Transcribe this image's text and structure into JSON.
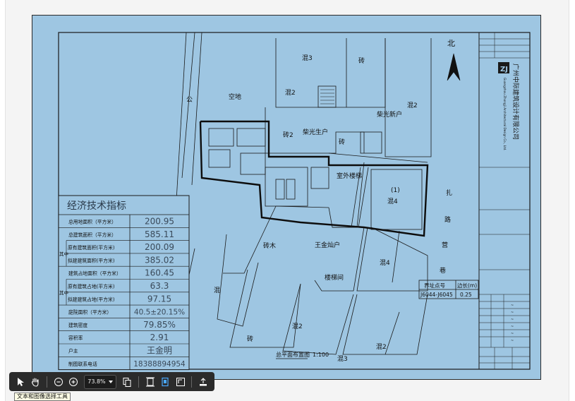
{
  "drawing": {
    "north_label": "北",
    "title_table": {
      "heading": "经济技术指标",
      "rows": [
        {
          "group": "",
          "label": "总用地面积（平方米）",
          "value": "200.95"
        },
        {
          "group": "",
          "label": "总建筑面积（平方米）",
          "value": "585.11"
        },
        {
          "group": "其中",
          "label": "原有建筑面积(平方米)",
          "value": "200.09"
        },
        {
          "group": "",
          "label": "拟建建筑面积(平方米)",
          "value": "385.02"
        },
        {
          "group": "",
          "label": "建筑占地面积（平方米）",
          "value": "160.45"
        },
        {
          "group": "其中",
          "label": "原有建筑占地(平方米)",
          "value": "63.3"
        },
        {
          "group": "",
          "label": "拟建建筑占地(平方米)",
          "value": "97.15"
        },
        {
          "group": "",
          "label": "庭院面积（平方米）",
          "value": "40.5±20.15%"
        },
        {
          "group": "",
          "label": "建筑密度",
          "value": "79.85%"
        },
        {
          "group": "",
          "label": "容积率",
          "value": "2.91"
        },
        {
          "group": "",
          "label": "户主",
          "value": "王金明"
        },
        {
          "group": "",
          "label": "制图联系电话",
          "value": "18388894954"
        }
      ]
    },
    "boundary_table": {
      "col1_header": "界址点号",
      "col2_header": "边长(m)",
      "col1_value": "J6044-J6045",
      "col2_value": "0.25"
    },
    "plan_title": "总平面布置图",
    "plan_scale": "1:100",
    "labels": {
      "kongdi": "空地",
      "hun3_top": "混3",
      "zhuan_top": "砖",
      "hun2_a": "混2",
      "zhuan2": "砖2",
      "chaiguang_sheng": "柴光生户",
      "chaiguang_xin": "柴光新户",
      "hun2_right": "混2",
      "zhuan_small": "砖",
      "shiwai_louti": "室外楼梯",
      "lot_1": "(1)",
      "hun4_a": "混4",
      "zhalu": "扎",
      "lu": "路",
      "ying": "营",
      "xiang": "巷",
      "zhuanmu": "砖木",
      "wangjincan": "王金灿户",
      "loutijian": "楼梯间",
      "hun4_b": "混4",
      "hun_left": "混",
      "hun2_b": "混2",
      "zhuan_bottom": "砖",
      "hun3_bottom": "混3",
      "hun2_c": "混2",
      "gong": "公"
    },
    "company": {
      "logo": "ZJ",
      "name_cn": "广州中际建筑设计有限公司",
      "name_en": "Guangzhou Zhongji Architectural Design Co., Ltd."
    }
  },
  "toolbar": {
    "zoom_value": "73.8%",
    "tooltip": "文本和图像选择工具"
  },
  "colors": {
    "paper": "#9ec6e2",
    "toolbar_bg": "#2b2b2b",
    "active_tool": "#4aa8ff"
  }
}
